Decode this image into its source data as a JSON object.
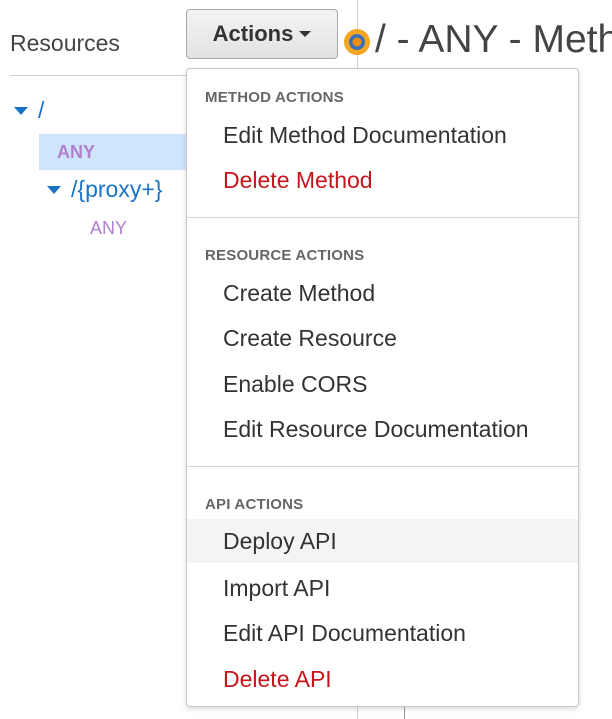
{
  "sidebar": {
    "title": "Resources",
    "tree": {
      "root_path": "/",
      "root_method": "ANY",
      "child_path": "/{proxy+}",
      "child_method": "ANY"
    }
  },
  "header": {
    "actions_label": "Actions",
    "title": "/ - ANY - Meth"
  },
  "menu": {
    "sections": [
      {
        "header": "METHOD ACTIONS",
        "items": [
          {
            "label": "Edit Method Documentation"
          },
          {
            "label": "Delete Method",
            "style": "danger"
          }
        ]
      },
      {
        "header": "RESOURCE ACTIONS",
        "items": [
          {
            "label": "Create Method"
          },
          {
            "label": "Create Resource"
          },
          {
            "label": "Enable CORS"
          },
          {
            "label": "Edit Resource Documentation"
          }
        ]
      },
      {
        "header": "API ACTIONS",
        "items": [
          {
            "label": "Deploy API",
            "state": "hovered"
          },
          {
            "label": "Import API"
          },
          {
            "label": "Edit API Documentation"
          },
          {
            "label": "Delete API",
            "style": "danger"
          }
        ]
      }
    ]
  },
  "colors": {
    "link_blue": "#1a73c7",
    "method_purple": "#b07fcf",
    "danger_red": "#c7151b",
    "selected_bg": "#cfe5fb",
    "icon_orange": "#f28c10"
  },
  "icons": {
    "method_icon": "method-target-icon",
    "expand_icon": "triangle-down-icon",
    "caret_icon": "caret-down-icon"
  }
}
